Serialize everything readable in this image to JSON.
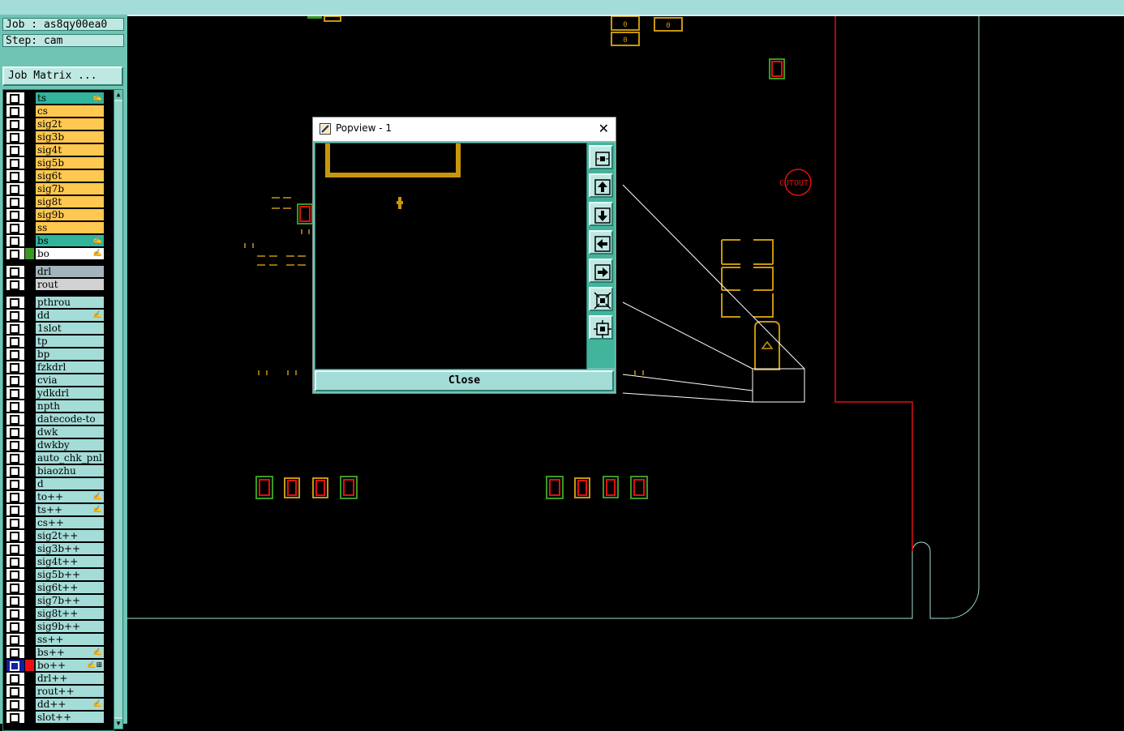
{
  "header": {
    "job": "Job : as8qy00ea0",
    "step": "Step: cam",
    "job_matrix_label": "Job Matrix ..."
  },
  "layers": [
    {
      "name": "ts",
      "color": "teal",
      "flag": "✍"
    },
    {
      "name": "cs",
      "color": "yellow"
    },
    {
      "name": "sig2t",
      "color": "yellow"
    },
    {
      "name": "sig3b",
      "color": "yellow"
    },
    {
      "name": "sig4t",
      "color": "yellow"
    },
    {
      "name": "sig5b",
      "color": "yellow"
    },
    {
      "name": "sig6t",
      "color": "yellow"
    },
    {
      "name": "sig7b",
      "color": "yellow"
    },
    {
      "name": "sig8t",
      "color": "yellow"
    },
    {
      "name": "sig9b",
      "color": "yellow"
    },
    {
      "name": "ss",
      "color": "yellow"
    },
    {
      "name": "bs",
      "color": "teal",
      "flag": "✍"
    },
    {
      "name": "bo",
      "color": "white",
      "flag": "✍",
      "swatch": "green"
    },
    {
      "name": "drl",
      "color": "grey",
      "gap_before": true
    },
    {
      "name": "rout",
      "color": "lgrey"
    },
    {
      "name": "pthrou",
      "color": "cyan",
      "gap_before": true
    },
    {
      "name": "dd",
      "color": "cyan",
      "flag": "✍"
    },
    {
      "name": "1slot",
      "color": "cyan"
    },
    {
      "name": "tp",
      "color": "cyan"
    },
    {
      "name": "bp",
      "color": "cyan"
    },
    {
      "name": "fzkdrl",
      "color": "cyan"
    },
    {
      "name": "cvia",
      "color": "cyan"
    },
    {
      "name": "ydkdrl",
      "color": "cyan"
    },
    {
      "name": "npth",
      "color": "cyan"
    },
    {
      "name": "datecode-to",
      "color": "cyan"
    },
    {
      "name": "dwk",
      "color": "cyan"
    },
    {
      "name": "dwkby",
      "color": "cyan"
    },
    {
      "name": "auto_chk_pnl",
      "color": "cyan"
    },
    {
      "name": "biaozhu",
      "color": "cyan"
    },
    {
      "name": "d",
      "color": "cyan"
    },
    {
      "name": "to++",
      "color": "cyan",
      "flag": "✍"
    },
    {
      "name": "ts++",
      "color": "cyan",
      "flag": "✍"
    },
    {
      "name": "cs++",
      "color": "cyan"
    },
    {
      "name": "sig2t++",
      "color": "cyan"
    },
    {
      "name": "sig3b++",
      "color": "cyan"
    },
    {
      "name": "sig4t++",
      "color": "cyan"
    },
    {
      "name": "sig5b++",
      "color": "cyan"
    },
    {
      "name": "sig6t++",
      "color": "cyan"
    },
    {
      "name": "sig7b++",
      "color": "cyan"
    },
    {
      "name": "sig8t++",
      "color": "cyan"
    },
    {
      "name": "sig9b++",
      "color": "cyan"
    },
    {
      "name": "ss++",
      "color": "cyan"
    },
    {
      "name": "bs++",
      "color": "cyan",
      "flag": "✍"
    },
    {
      "name": "bo++",
      "color": "cyan",
      "flag": "✍⊞",
      "swatch": "red",
      "selected": true
    },
    {
      "name": "drl++",
      "color": "cyan"
    },
    {
      "name": "rout++",
      "color": "cyan"
    },
    {
      "name": "dd++",
      "color": "cyan",
      "flag": "✍"
    },
    {
      "name": "slot++",
      "color": "cyan"
    }
  ],
  "canvas": {
    "cutout_label": "CUTOUT",
    "pad_label": "0"
  },
  "popview": {
    "title": "Popview - 1",
    "close_label": "Close",
    "tools": [
      "zoom-fit-icon",
      "pan-up-icon",
      "pan-down-icon",
      "pan-left-icon",
      "pan-right-icon",
      "zoom-in-icon",
      "zoom-out-icon"
    ]
  },
  "colors": {
    "panel": "#6fc4b4",
    "layer_yellow": "#ffc850",
    "layer_teal": "#30b49c",
    "copper": "#c8960c",
    "outline_red": "#e01010"
  }
}
